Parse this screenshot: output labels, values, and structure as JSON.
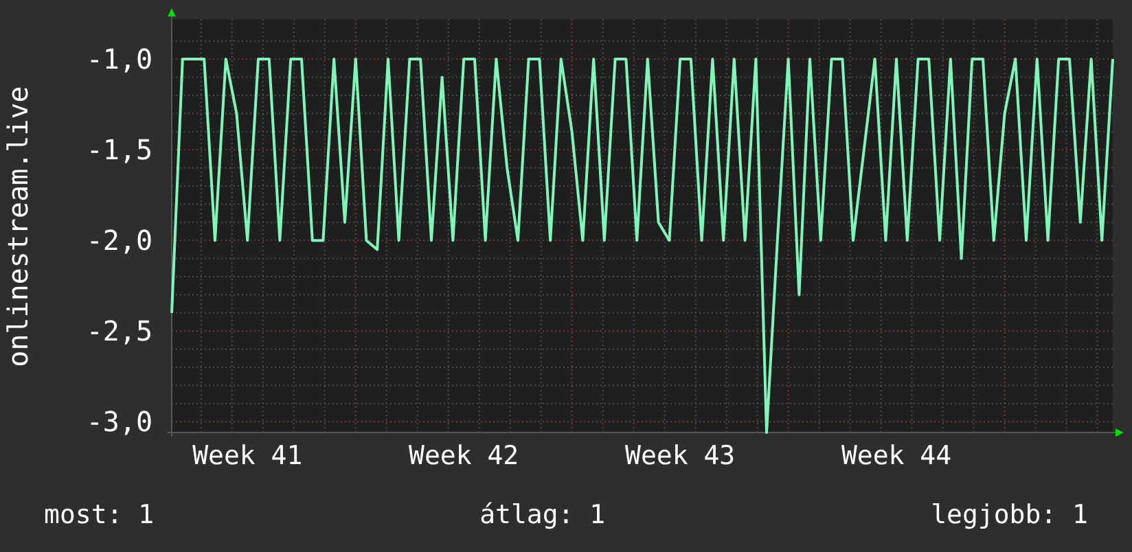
{
  "chart": {
    "chart_data": {
      "type": "line",
      "grid": true,
      "ylabel": "onlinestream.live",
      "ylim": [
        -3.06,
        -0.78
      ],
      "yticks": [
        {
          "value": -1,
          "label": "-1,0"
        },
        {
          "value": -1.5,
          "label": "-1,5"
        },
        {
          "value": -2,
          "label": "-2,0"
        },
        {
          "value": -2.5,
          "label": "-2,5"
        },
        {
          "value": -3,
          "label": "-3,0"
        }
      ],
      "categories": [
        null,
        null,
        null,
        null,
        null,
        null,
        null,
        "Week 41",
        null,
        null,
        null,
        null,
        null,
        null,
        null,
        null,
        null,
        null,
        null,
        null,
        null,
        null,
        null,
        null,
        null,
        null,
        null,
        "Week 42",
        null,
        null,
        null,
        null,
        null,
        null,
        null,
        null,
        null,
        null,
        null,
        null,
        null,
        null,
        null,
        null,
        null,
        null,
        null,
        "Week 43",
        null,
        null,
        null,
        null,
        null,
        null,
        null,
        null,
        null,
        null,
        null,
        null,
        null,
        null,
        null,
        null,
        null,
        null,
        null,
        "Week 44",
        null,
        null,
        null,
        null,
        null,
        null,
        null,
        null,
        null,
        null,
        null,
        null,
        null,
        null,
        null,
        null,
        null,
        null,
        null,
        null
      ],
      "series": [
        {
          "color": "#7ff5b8",
          "values": [
            -2.4,
            -1,
            -1,
            -1,
            -2,
            -1,
            -1.3,
            -2,
            -1,
            -1,
            -2,
            -1,
            -1,
            -2,
            -2,
            -1,
            -1.9,
            -1,
            -2,
            -2.05,
            -1,
            -2,
            -1,
            -1,
            -2,
            -1.1,
            -2,
            -1,
            -1,
            -2,
            -1,
            -1.6,
            -2,
            -1,
            -1,
            -2,
            -1,
            -1.4,
            -2,
            -1,
            -2,
            -1,
            -1,
            -2,
            -1,
            -1.9,
            -2,
            -1,
            -1,
            -2,
            -1,
            -2,
            -1,
            -2,
            -1,
            -3.06,
            -2,
            -1,
            -2.3,
            -1,
            -2,
            -1,
            -1,
            -2,
            -1.5,
            -1,
            -2,
            -1,
            -2,
            -1,
            -1,
            -2,
            -1,
            -2.1,
            -1,
            -1,
            -2,
            -1.3,
            -1,
            -2,
            -1,
            -2,
            -1,
            -1,
            -1.9,
            -1,
            -2,
            -1
          ]
        }
      ]
    }
  },
  "legend": [
    {
      "label": "most: 1"
    },
    {
      "label": "átlag: 1"
    },
    {
      "label": "legjobb: 1"
    }
  ]
}
